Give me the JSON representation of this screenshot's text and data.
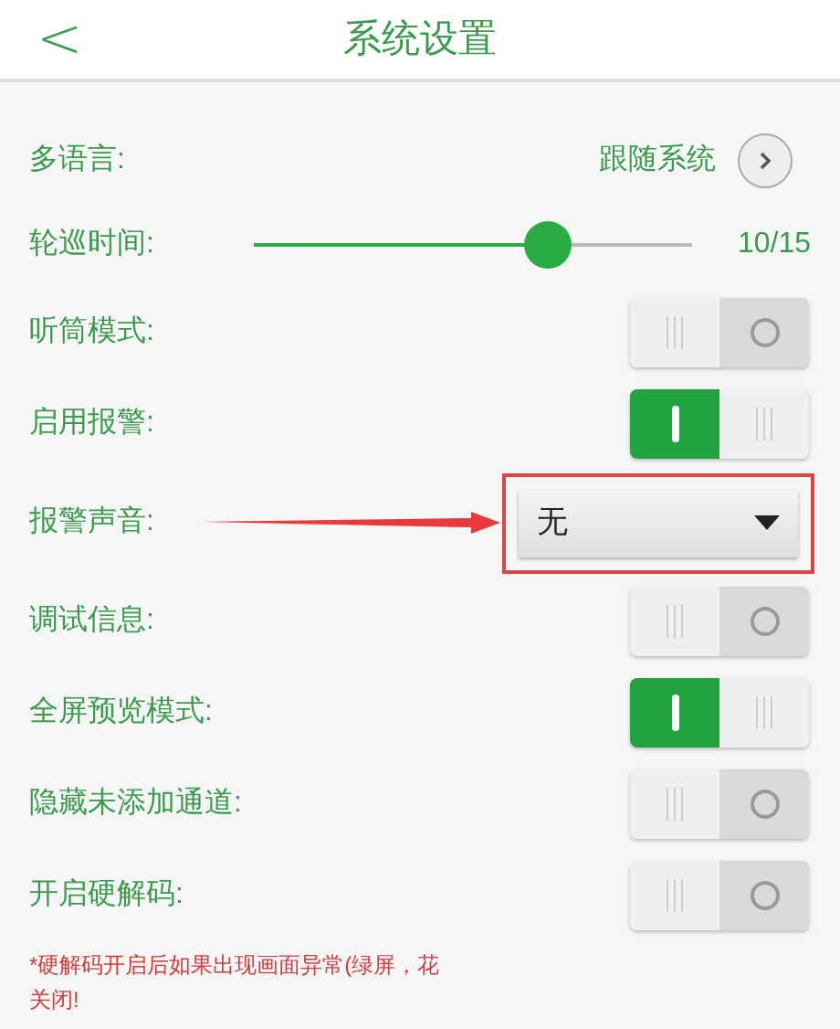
{
  "header": {
    "back": "<",
    "title": "系统设置"
  },
  "settings": [
    {
      "kind": "link",
      "label": "多语言:",
      "value": "跟随系统"
    },
    {
      "kind": "slider",
      "label": "轮巡时间:",
      "level": 0.67,
      "reading": "10/15"
    },
    {
      "kind": "toggle",
      "label": "听筒模式:",
      "on": false
    },
    {
      "kind": "toggle",
      "label": "启用报警:",
      "on": true
    },
    {
      "kind": "dropdown",
      "label": "报警声音:",
      "value": "无",
      "highlighted": true
    },
    {
      "kind": "toggle",
      "label": "调试信息:",
      "on": false
    },
    {
      "kind": "toggle",
      "label": "全屏预览模式:",
      "on": true
    },
    {
      "kind": "toggle",
      "label": "隐藏未添加通道:",
      "on": false
    },
    {
      "kind": "toggle",
      "label": "开启硬解码:",
      "on": false
    }
  ],
  "note_lines": [
    "*硬解码开启后如果出现画面异常(绿屏，花",
    "关闭!"
  ]
}
